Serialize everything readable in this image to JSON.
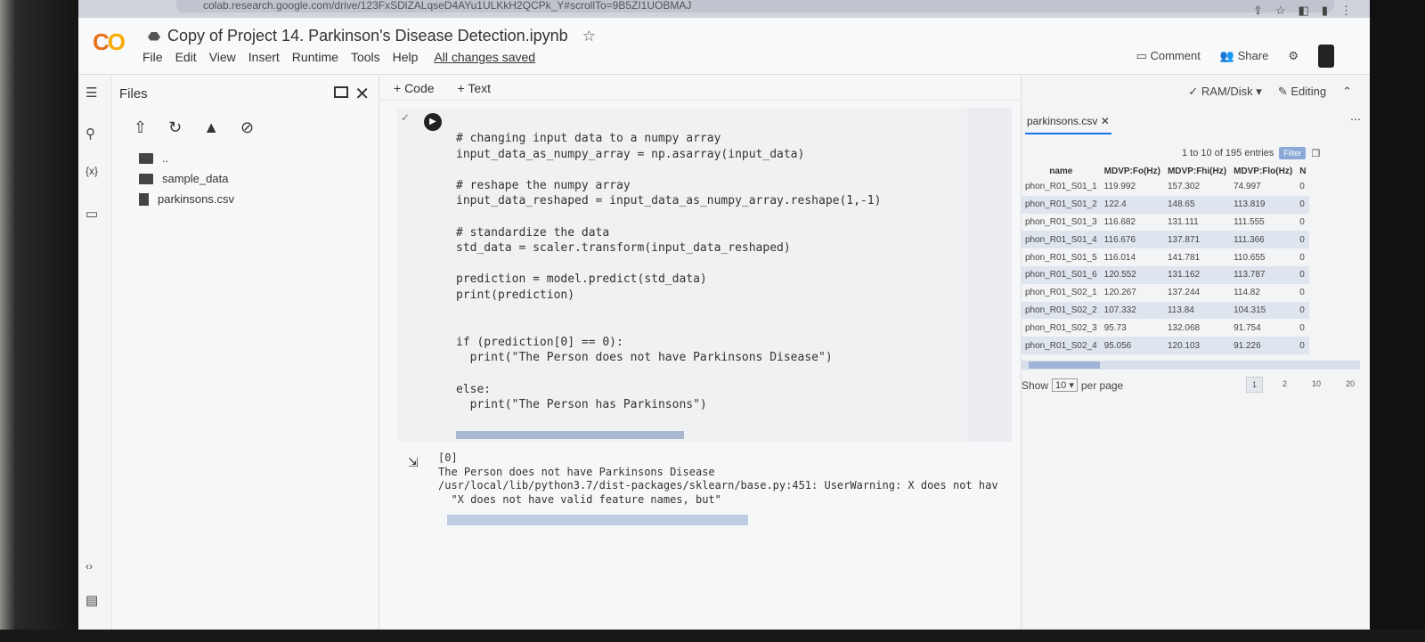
{
  "browser": {
    "url": "colab.research.google.com/drive/123FxSDlZALqseD4AYu1ULKkH2QCPk_Y#scrollTo=9B5ZI1UOBMAJ"
  },
  "header": {
    "logo": "CO",
    "title": "Copy of Project 14. Parkinson's Disease Detection.ipynb",
    "menu": [
      "File",
      "Edit",
      "View",
      "Insert",
      "Runtime",
      "Tools",
      "Help"
    ],
    "saved": "All changes saved",
    "comment": "Comment",
    "share": "Share"
  },
  "files": {
    "title": "Files",
    "items": [
      ".. ",
      "sample_data",
      "parkinsons.csv"
    ]
  },
  "toolbar": {
    "code": "+ Code",
    "text": "+ Text",
    "editing": "Editing",
    "ram": "RAM",
    "disk": "Disk"
  },
  "cell": {
    "code": "# changing input data to a numpy array\ninput_data_as_numpy_array = np.asarray(input_data)\n\n# reshape the numpy array\ninput_data_reshaped = input_data_as_numpy_array.reshape(1,-1)\n\n# standardize the data\nstd_data = scaler.transform(input_data_reshaped)\n\nprediction = model.predict(std_data)\nprint(prediction)\n\n\nif (prediction[0] == 0):\n  print(\"The Person does not have Parkinsons Disease\")\n\nelse:\n  print(\"The Person has Parkinsons\")",
    "output": "[0]\nThe Person does not have Parkinsons Disease\n/usr/local/lib/python3.7/dist-packages/sklearn/base.py:451: UserWarning: X does not hav\n  \"X does not have valid feature names, but\""
  },
  "data_panel": {
    "tab": "parkinsons.csv",
    "entries": "1 to 10 of 195 entries",
    "filter": "Filter",
    "columns": [
      "name",
      "MDVP:Fo(Hz)",
      "MDVP:Fhi(Hz)",
      "MDVP:Flo(Hz)",
      "N"
    ],
    "rows": [
      [
        "phon_R01_S01_1",
        "119.992",
        "157.302",
        "74.997",
        "0"
      ],
      [
        "phon_R01_S01_2",
        "122.4",
        "148.65",
        "113.819",
        "0"
      ],
      [
        "phon_R01_S01_3",
        "116.682",
        "131.111",
        "111.555",
        "0"
      ],
      [
        "phon_R01_S01_4",
        "116.676",
        "137.871",
        "111.366",
        "0"
      ],
      [
        "phon_R01_S01_5",
        "116.014",
        "141.781",
        "110.655",
        "0"
      ],
      [
        "phon_R01_S01_6",
        "120.552",
        "131.162",
        "113.787",
        "0"
      ],
      [
        "phon_R01_S02_1",
        "120.267",
        "137.244",
        "114.82",
        "0"
      ],
      [
        "phon_R01_S02_2",
        "107.332",
        "113.84",
        "104.315",
        "0"
      ],
      [
        "phon_R01_S02_3",
        "95.73",
        "132.068",
        "91.754",
        "0"
      ],
      [
        "phon_R01_S02_4",
        "95.056",
        "120.103",
        "91.226",
        "0"
      ]
    ],
    "show_label": "Show",
    "per_page_value": "10",
    "per_page_label": "per page",
    "pages": [
      "1",
      "2",
      "10",
      "20"
    ]
  }
}
